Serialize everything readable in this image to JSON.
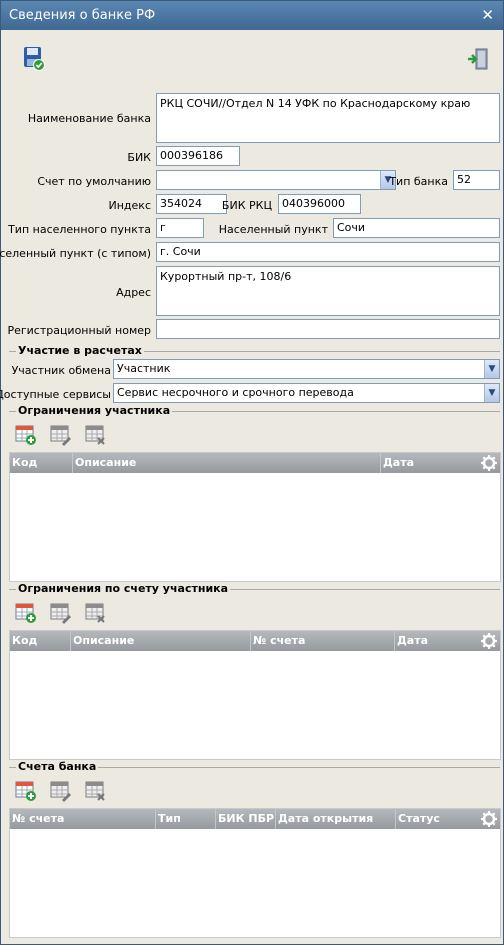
{
  "window": {
    "title": "Сведения о банке РФ",
    "close": "✕"
  },
  "toolbar": {
    "save_icon": "save-icon",
    "exit_icon": "exit-icon"
  },
  "form": {
    "bank_name_label": "Наименование банка",
    "bank_name_value": "РКЦ СОЧИ//Отдел N 14 УФК по Краснодарскому краю",
    "bik_label": "БИК",
    "bik_value": "000396186",
    "default_account_label": "Счет по умолчанию",
    "default_account_value": "",
    "bank_type_label": "Тип банка",
    "bank_type_value": "52",
    "index_label": "Индекс",
    "index_value": "354024",
    "bik_rkc_label": "БИК РКЦ",
    "bik_rkc_value": "040396000",
    "locality_type_label": "Тип населенного пункта",
    "locality_type_value": "г",
    "locality_label": "Населенный пункт",
    "locality_value": "Сочи",
    "locality_with_type_label": "Населенный пункт (с типом)",
    "locality_with_type_value": "г. Сочи",
    "address_label": "Адрес",
    "address_value": "Курортный пр-т, 108/6",
    "reg_number_label": "Регистрационный номер",
    "reg_number_value": ""
  },
  "settlements": {
    "title": "Участие в расчетах",
    "exchange_label": "Участник обмена",
    "exchange_value": "Участник",
    "services_label": "Доступные сервисы",
    "services_value": "Сервис несрочного и срочного перевода"
  },
  "restrictions": {
    "title": "Ограничения участника",
    "columns": [
      "Код",
      "Описание",
      "Дата"
    ]
  },
  "account_restrictions": {
    "title": "Ограничения по счету участника",
    "columns": [
      "Код",
      "Описание",
      "№ счета",
      "Дата"
    ]
  },
  "bank_accounts": {
    "title": "Счета банка",
    "columns": [
      "№ счета",
      "Тип",
      "БИК ПБР",
      "Дата открытия",
      "Статус"
    ]
  },
  "colors": {
    "titlebar": "#4a76a2",
    "grid_header": "#a3a7ab",
    "field_border": "#7f9db9"
  }
}
